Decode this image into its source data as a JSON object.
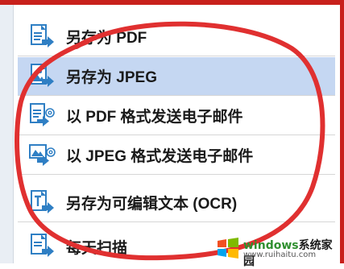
{
  "menu": {
    "items": [
      {
        "label": "另存为 PDF",
        "icon": "save-as-pdf-icon",
        "selected": false
      },
      {
        "label": "另存为 JPEG",
        "icon": "save-as-jpeg-icon",
        "selected": true
      },
      {
        "label": "以 PDF 格式发送电子邮件",
        "icon": "email-pdf-icon",
        "selected": false
      },
      {
        "label": "以 JPEG 格式发送电子邮件",
        "icon": "email-jpeg-icon",
        "selected": false
      },
      {
        "label": "另存为可编辑文本 (OCR)",
        "icon": "save-ocr-text-icon",
        "selected": false
      },
      {
        "label": "每天扫描",
        "icon": "daily-scan-icon",
        "selected": false
      }
    ]
  },
  "watermark": {
    "brand": "windows",
    "suffix": "系统家园",
    "url": "www.ruihaitu.com"
  },
  "colors": {
    "annotation_red": "#e03030",
    "frame_red": "#c8211c",
    "selected_bg": "#c5d7f2",
    "icon_blue": "#2f7fc4"
  }
}
